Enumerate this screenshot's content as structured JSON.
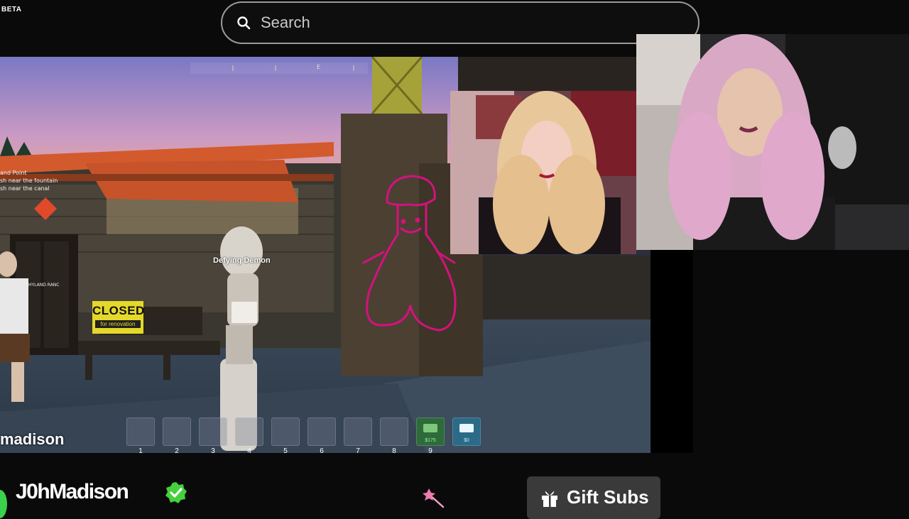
{
  "header": {
    "beta_label": "BETA",
    "search_placeholder": "Search"
  },
  "game": {
    "compass_marker": "E",
    "objectives": [
      "and Point",
      "sh near the fountain",
      "sh near the canal"
    ],
    "location_logo_text": "HYLAND RANC",
    "npc_name": "Defying Demon",
    "sign_title": "CLOSED",
    "sign_subtitle": "for renovation",
    "player_name": "madison",
    "hotbar": {
      "slots": [
        "1",
        "2",
        "3",
        "4",
        "5",
        "6",
        "7",
        "8",
        "9"
      ],
      "cash_value": "$175",
      "card_value": "$0"
    }
  },
  "footer": {
    "streamer_name": "J0hMadison",
    "gift_button_label": "Gift Subs"
  },
  "colors": {
    "accent_green": "#3bd14a",
    "verified_green": "#45d13c",
    "graffiti_magenta": "#d4127e",
    "button_bg": "#3a3a3a"
  }
}
